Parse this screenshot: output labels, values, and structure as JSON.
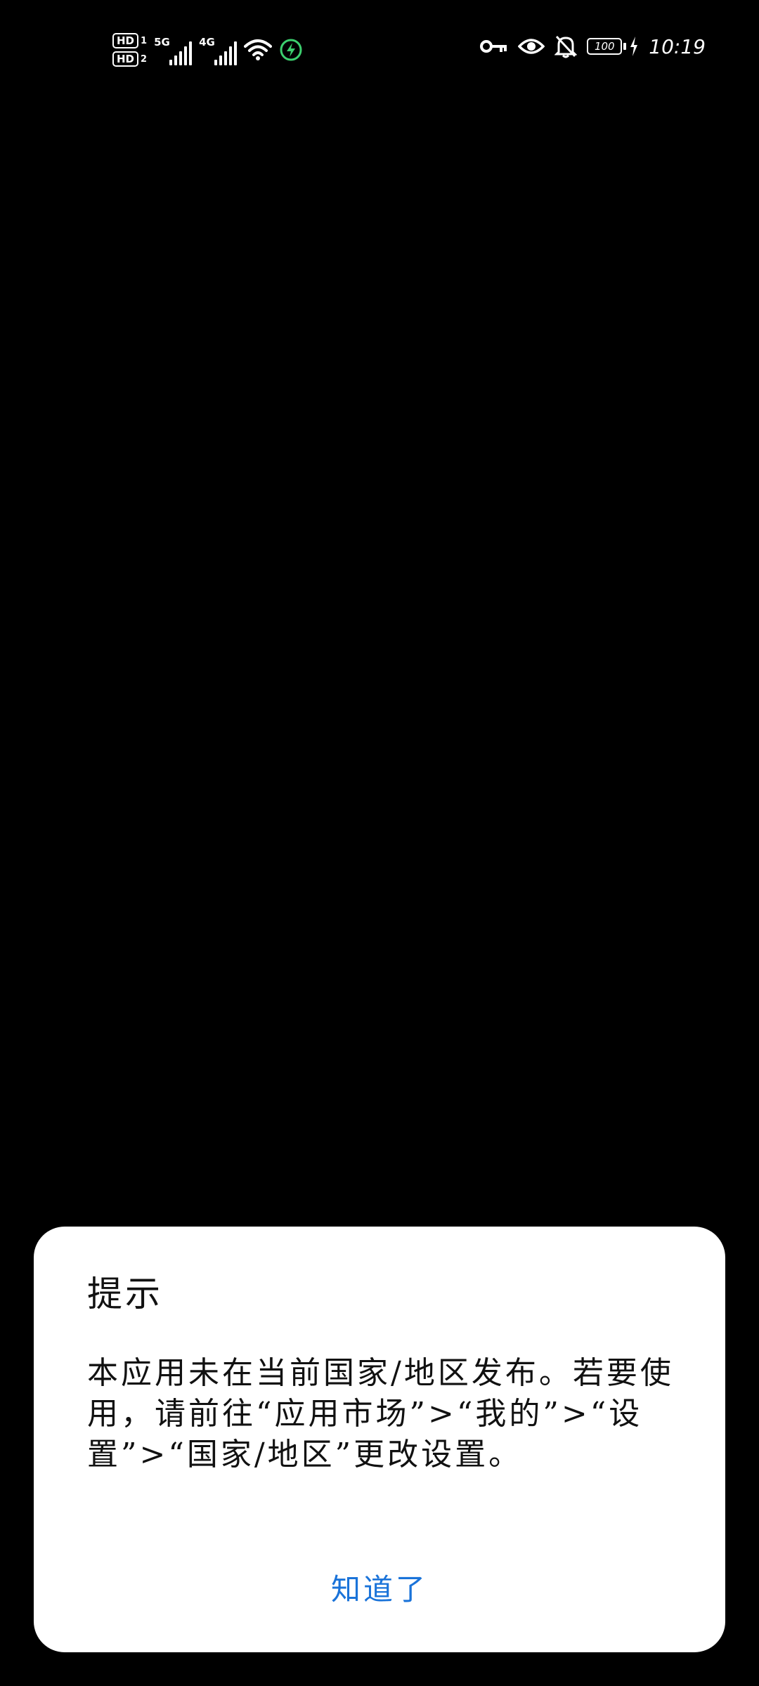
{
  "status_bar": {
    "sim1_badge": "HD",
    "sim1_index": "1",
    "sim2_badge": "HD",
    "sim2_index": "2",
    "sim1_network": "5G",
    "sim2_network": "4G",
    "icons": [
      "wifi-icon",
      "charging-icon",
      "key-icon",
      "eye-icon",
      "bell-muted-icon"
    ],
    "battery_level": "100",
    "time": "10:19"
  },
  "dialog": {
    "title": "提示",
    "message": "本应用未在当前国家/地区发布。若要使用，请前往“应用市场”>“我的”>“设置”>“国家/地区”更改设置。",
    "confirm_label": "知道了",
    "accent_color": "#1a73d9"
  }
}
